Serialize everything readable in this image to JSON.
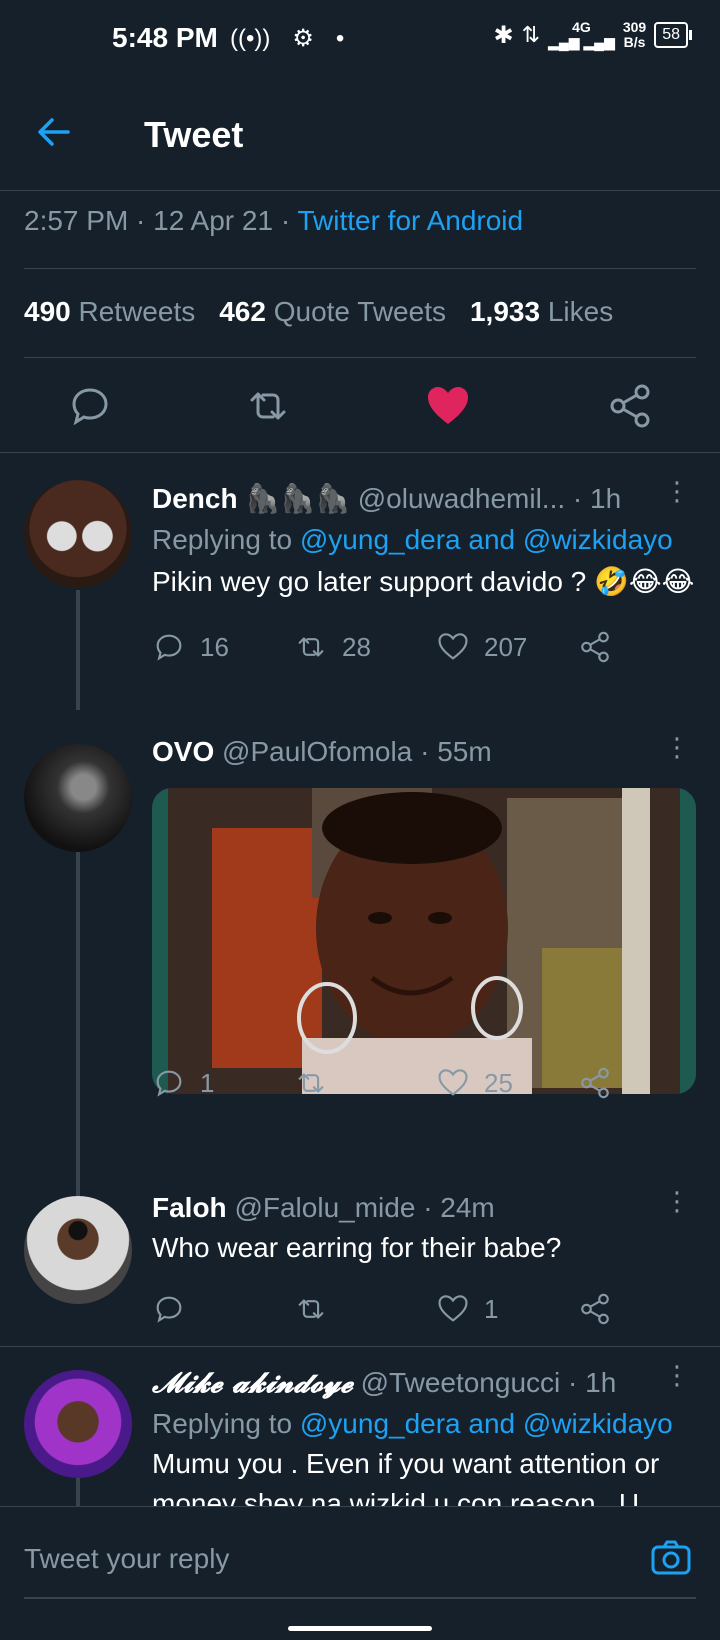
{
  "status_bar": {
    "time": "5:48 PM",
    "net_top": "4G",
    "speed": "309",
    "speed_unit": "B/s",
    "battery": "58"
  },
  "header": {
    "title": "Tweet"
  },
  "meta": {
    "time": "2:57 PM",
    "date": "12 Apr 21",
    "source": "Twitter for Android"
  },
  "stats": {
    "retweets_count": "490",
    "retweets_label": "Retweets",
    "quotes_count": "462",
    "quotes_label": "Quote Tweets",
    "likes_count": "1,933",
    "likes_label": "Likes"
  },
  "colors": {
    "bg": "#15202b",
    "accent": "#1da1f2",
    "like": "#e0245e",
    "muted": "#8899a6"
  },
  "replies": [
    {
      "name": "Dench",
      "emoji": "🦍🦍🦍",
      "handle": "@oluwadhemil...",
      "time": "· 1h",
      "replying_prefix": "Replying to",
      "replying_to": "@yung_dera and @wizkidayo",
      "text": "Pikin wey go later support davido ? 🤣😂😂",
      "replies": "16",
      "retweets": "28",
      "likes": "207"
    },
    {
      "name": "OVO",
      "handle": "@PaulOfomola",
      "time": "· 55m",
      "replies": "1",
      "retweets": "",
      "likes": "25"
    },
    {
      "name": "Faloh",
      "handle": "@Falolu_mide",
      "time": "· 24m",
      "text": "Who wear earring for their babe?",
      "replies": "",
      "retweets": "",
      "likes": "1"
    },
    {
      "name": "𝓜𝓲𝓴𝓮 𝓪𝓴𝓲𝓷𝓭𝓸𝔂𝓮",
      "handle": "@Tweetongucci",
      "time": "· 1h",
      "replying_prefix": "Replying to",
      "replying_to": "@yung_dera and @wizkidayo",
      "text": "Mumu you . Even if you want attention or money shey na wizkid u con reason . U"
    }
  ],
  "compose": {
    "placeholder": "Tweet your reply"
  }
}
